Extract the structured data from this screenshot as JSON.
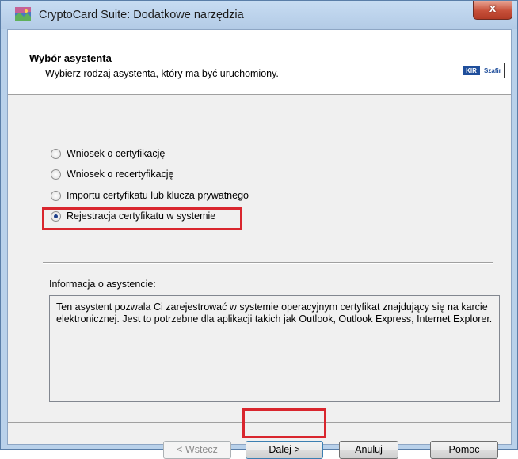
{
  "window": {
    "title": "CryptoCard Suite: Dodatkowe narzędzia",
    "close_glyph": "x"
  },
  "header": {
    "title": "Wybór asystenta",
    "subtitle": "Wybierz rodzaj asystenta, który ma być uruchomiony.",
    "logo": {
      "kir": "KIR",
      "szafir": "Szafir"
    }
  },
  "options": [
    {
      "label": "Wniosek o certyfikację",
      "selected": false
    },
    {
      "label": "Wniosek o recertyfikację",
      "selected": false
    },
    {
      "label": "Importu certyfikatu lub klucza prywatnego",
      "selected": false
    },
    {
      "label": "Rejestracja certyfikatu w systemie",
      "selected": true
    }
  ],
  "info": {
    "label": "Informacja o asystencie:",
    "text": "Ten asystent pozwala Ci zarejestrować w systemie operacyjnym certyfikat znajdujący się na karcie elektronicznej. Jest to potrzebne dla aplikacji takich jak Outlook, Outlook Express, Internet Explorer."
  },
  "buttons": {
    "back": "< Wstecz",
    "next": "Dalej >",
    "cancel": "Anuluj",
    "help": "Pomoc"
  },
  "colors": {
    "highlight": "#d9262e",
    "titlebar": "#b9d1ea",
    "close": "#c7503a"
  }
}
